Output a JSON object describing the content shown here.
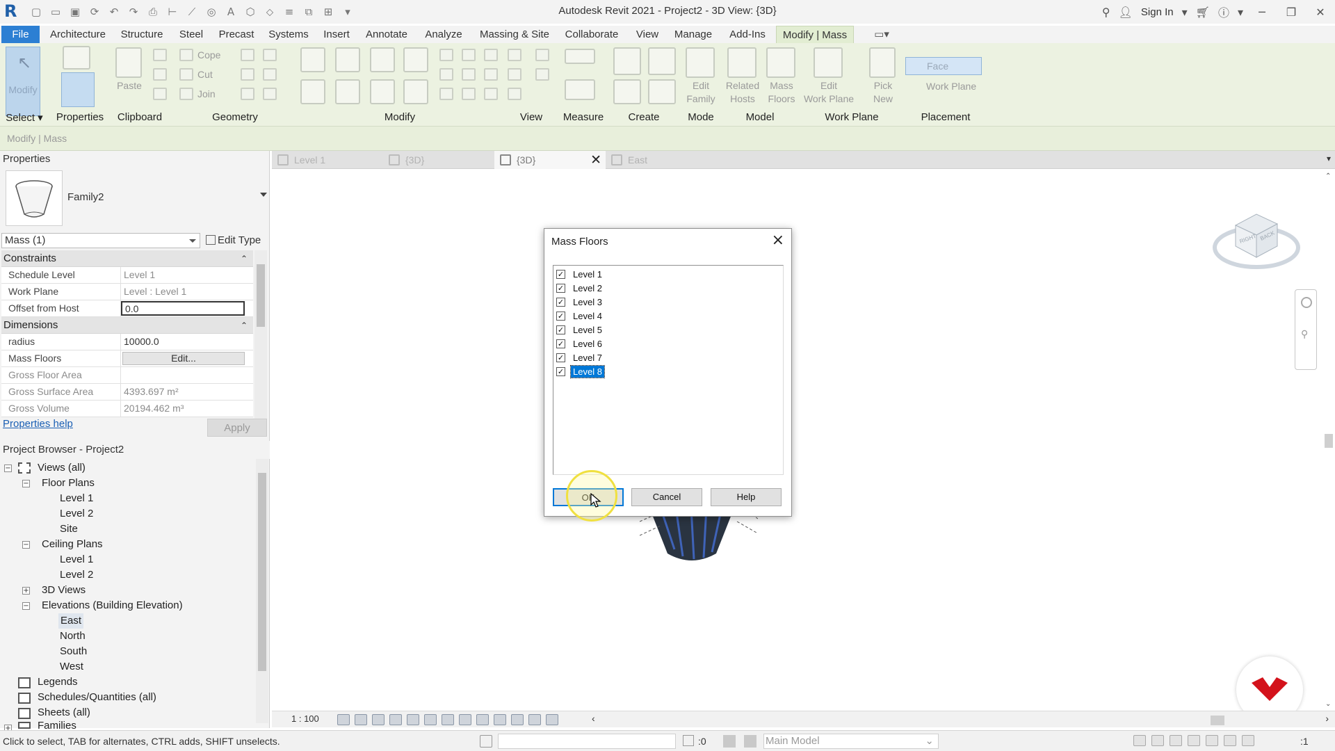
{
  "app": {
    "title": "Autodesk Revit 2021 - Project2 - 3D View: {3D}",
    "sign_in": "Sign In"
  },
  "ribbon_tabs": [
    "File",
    "Architecture",
    "Structure",
    "Steel",
    "Precast",
    "Systems",
    "Insert",
    "Annotate",
    "Analyze",
    "Massing & Site",
    "Collaborate",
    "View",
    "Manage",
    "Add-Ins",
    "Modify | Mass"
  ],
  "ribbon": {
    "panels": [
      "Select",
      "Properties",
      "Clipboard",
      "Geometry",
      "Modify",
      "View",
      "Measure",
      "Create",
      "Mode",
      "Model",
      "Work Plane",
      "Placement"
    ],
    "buttons": {
      "modify": "Modify",
      "paste": "Paste",
      "cope": "Cope",
      "cut": "Cut",
      "join": "Join",
      "edit_family_1": "Edit",
      "edit_family_2": "Family",
      "related_hosts_1": "Related",
      "related_hosts_2": "Hosts",
      "mass_floors_1": "Mass",
      "mass_floors_2": "Floors",
      "edit_work_plane_1": "Edit",
      "edit_work_plane_2": "Work Plane",
      "pick_new_1": "Pick",
      "pick_new_2": "New",
      "face": "Face",
      "work_plane": "Work Plane"
    }
  },
  "options_bar": "Modify | Mass",
  "properties": {
    "header": "Properties",
    "family": "Family2",
    "instance": "Mass (1)",
    "edit_type": "Edit Type",
    "categories": {
      "constraints": "Constraints",
      "dimensions": "Dimensions"
    },
    "rows": {
      "schedule_level": {
        "name": "Schedule Level",
        "value": "Level 1"
      },
      "work_plane": {
        "name": "Work Plane",
        "value": "Level : Level 1"
      },
      "offset": {
        "name": "Offset from Host",
        "value": "0.0"
      },
      "radius": {
        "name": "radius",
        "value": "10000.0"
      },
      "mass_floors": {
        "name": "Mass Floors",
        "value": "Edit..."
      },
      "gross_floor": {
        "name": "Gross Floor Area",
        "value": ""
      },
      "gross_surface": {
        "name": "Gross Surface Area",
        "value": "4393.697 m²"
      },
      "gross_volume": {
        "name": "Gross Volume",
        "value": "20194.462 m³"
      }
    },
    "help": "Properties help",
    "apply": "Apply"
  },
  "browser": {
    "header": "Project Browser - Project2",
    "views_all": "Views (all)",
    "floor_plans": "Floor Plans",
    "fp_level1": "Level 1",
    "fp_level2": "Level 2",
    "fp_site": "Site",
    "ceiling_plans": "Ceiling Plans",
    "cp_level1": "Level 1",
    "cp_level2": "Level 2",
    "views_3d": "3D Views",
    "elevations": "Elevations (Building Elevation)",
    "east": "East",
    "north": "North",
    "south": "South",
    "west": "West",
    "legends": "Legends",
    "schedules": "Schedules/Quantities (all)",
    "sheets": "Sheets (all)",
    "families": "Families"
  },
  "view_tabs": [
    {
      "label": "Level 1"
    },
    {
      "label": "{3D}"
    },
    {
      "label": "{3D}"
    },
    {
      "label": "East"
    }
  ],
  "view_control": {
    "scale": "1 : 100"
  },
  "status": {
    "text": "Click to select, TAB for alternates, CTRL adds, SHIFT unselects.",
    "count": ":0",
    "model": "Main Model",
    "filter": ":1"
  },
  "dialog": {
    "title": "Mass Floors",
    "items": [
      {
        "label": "Level 1",
        "checked": true
      },
      {
        "label": "Level 2",
        "checked": true
      },
      {
        "label": "Level 3",
        "checked": true
      },
      {
        "label": "Level 4",
        "checked": true
      },
      {
        "label": "Level 5",
        "checked": true
      },
      {
        "label": "Level 6",
        "checked": true
      },
      {
        "label": "Level 7",
        "checked": true
      },
      {
        "label": "Level 8",
        "checked": true
      }
    ],
    "ok": "OK",
    "cancel": "Cancel",
    "help": "Help"
  },
  "colors": {
    "accent": "#2c7fd3",
    "contextual_tab": "#e2edd2",
    "selection": "#0078d7"
  }
}
